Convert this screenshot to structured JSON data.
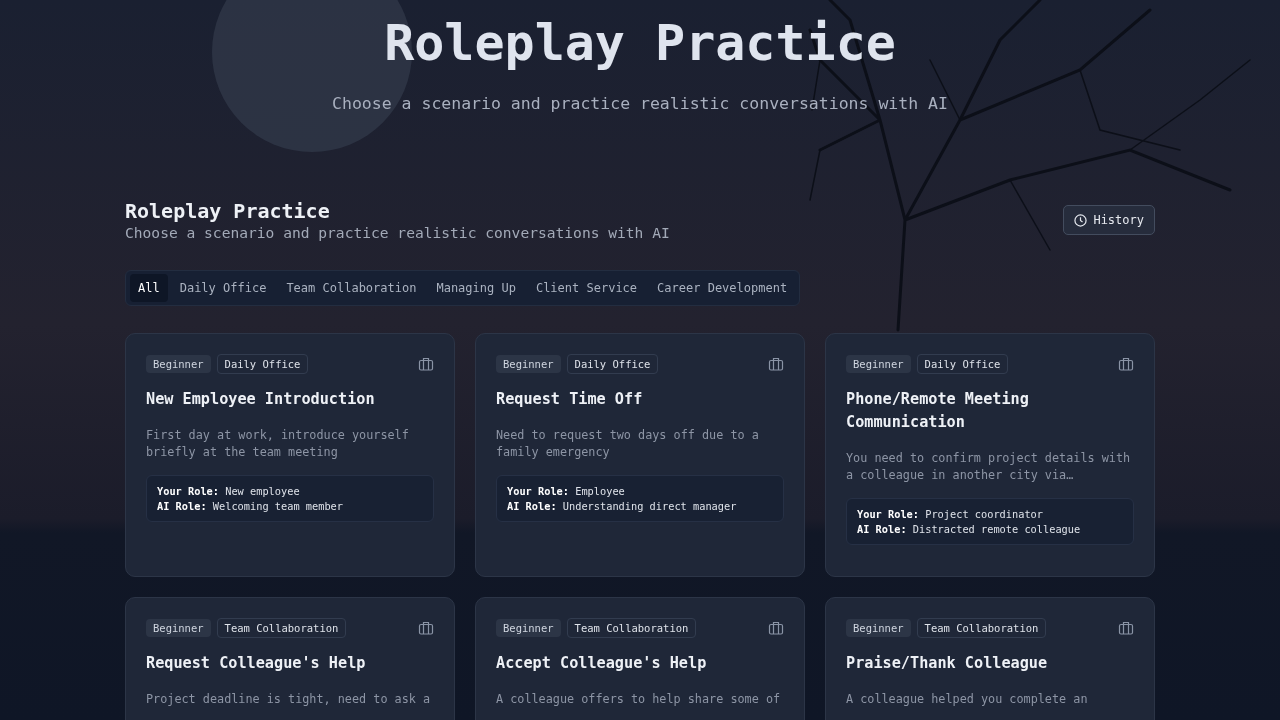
{
  "hero": {
    "title": "Roleplay Practice",
    "subtitle": "Choose a scenario and practice realistic conversations with AI"
  },
  "section": {
    "title": "Roleplay Practice",
    "subtitle": "Choose a scenario and practice realistic conversations with AI",
    "history_button": "History"
  },
  "tabs": [
    {
      "label": "All",
      "selected": true
    },
    {
      "label": "Daily Office",
      "selected": false
    },
    {
      "label": "Team Collaboration",
      "selected": false
    },
    {
      "label": "Managing Up",
      "selected": false
    },
    {
      "label": "Client Service",
      "selected": false
    },
    {
      "label": "Career Development",
      "selected": false
    }
  ],
  "cards": [
    {
      "tags": [
        {
          "text": "Beginner",
          "kind": "level"
        },
        {
          "text": "Daily Office",
          "kind": "category"
        }
      ],
      "title": "New Employee Introduction",
      "description": "First day at work, introduce yourself briefly at the team meeting",
      "roles": [
        {
          "label": "Your Role:",
          "value": "New employee"
        },
        {
          "label": "AI Role:",
          "value": "Welcoming team member"
        }
      ]
    },
    {
      "tags": [
        {
          "text": "Beginner",
          "kind": "level"
        },
        {
          "text": "Daily Office",
          "kind": "category"
        }
      ],
      "title": "Request Time Off",
      "description": "Need to request two days off due to a family emergency",
      "roles": [
        {
          "label": "Your Role:",
          "value": "Employee"
        },
        {
          "label": "AI Role:",
          "value": "Understanding direct manager"
        }
      ]
    },
    {
      "tags": [
        {
          "text": "Beginner",
          "kind": "level"
        },
        {
          "text": "Daily Office",
          "kind": "category"
        }
      ],
      "title": "Phone/Remote Meeting Communication",
      "description": "You need to confirm project details with a colleague in another city via…",
      "roles": [
        {
          "label": "Your Role:",
          "value": "Project coordinator"
        },
        {
          "label": "AI Role:",
          "value": "Distracted remote colleague"
        }
      ]
    },
    {
      "tags": [
        {
          "text": "Beginner",
          "kind": "level"
        },
        {
          "text": "Team Collaboration",
          "kind": "category"
        }
      ],
      "title": "Request Colleague's Help",
      "description": "Project deadline is tight, need to ask a"
    },
    {
      "tags": [
        {
          "text": "Beginner",
          "kind": "level"
        },
        {
          "text": "Team Collaboration",
          "kind": "category"
        }
      ],
      "title": "Accept Colleague's Help",
      "description": "A colleague offers to help share some of"
    },
    {
      "tags": [
        {
          "text": "Beginner",
          "kind": "level"
        },
        {
          "text": "Team Collaboration",
          "kind": "category"
        }
      ],
      "title": "Praise/Thank Colleague",
      "description": "A colleague helped you complete an"
    }
  ]
}
